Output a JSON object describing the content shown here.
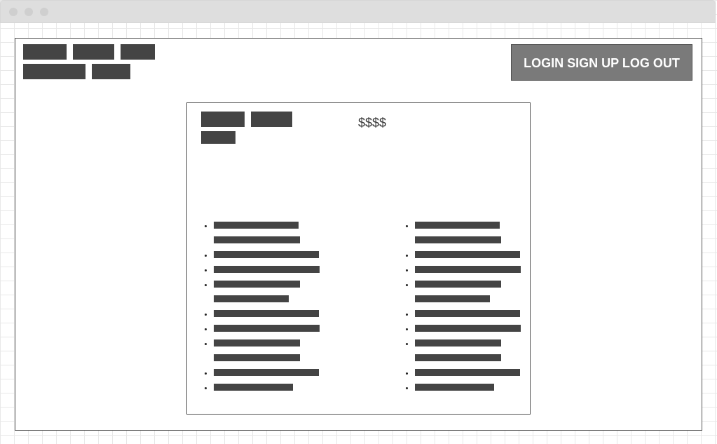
{
  "window": {
    "controls": [
      "close-dot",
      "minimize-dot",
      "zoom-dot"
    ]
  },
  "header": {
    "auth_button_label": "LOGIN SIGN UP LOG OUT"
  },
  "product": {
    "price": "$$$$"
  },
  "colors": {
    "placeholder": "#444444",
    "auth_button_bg": "#7a7a7a",
    "titlebar": "#dedede"
  }
}
